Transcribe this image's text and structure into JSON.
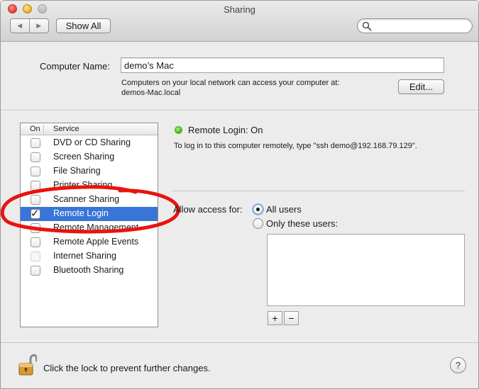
{
  "window": {
    "title": "Sharing"
  },
  "toolbar": {
    "back_label": "◀",
    "forward_label": "▶",
    "show_all_label": "Show All",
    "search": {
      "value": "",
      "placeholder": ""
    }
  },
  "computer_name": {
    "label": "Computer Name:",
    "value": "demo’s Mac",
    "info_line1": "Computers on your local network can access your computer at:",
    "info_line2": "demos-Mac.local",
    "edit_label": "Edit..."
  },
  "services": {
    "header_on": "On",
    "header_service": "Service",
    "items": [
      {
        "label": "DVD or CD Sharing",
        "checked": false,
        "enabled": true,
        "selected": false
      },
      {
        "label": "Screen Sharing",
        "checked": false,
        "enabled": true,
        "selected": false
      },
      {
        "label": "File Sharing",
        "checked": false,
        "enabled": true,
        "selected": false
      },
      {
        "label": "Printer Sharing",
        "checked": false,
        "enabled": true,
        "selected": false
      },
      {
        "label": "Scanner Sharing",
        "checked": false,
        "enabled": true,
        "selected": false
      },
      {
        "label": "Remote Login",
        "checked": true,
        "enabled": true,
        "selected": true
      },
      {
        "label": "Remote Management",
        "checked": false,
        "enabled": true,
        "selected": false
      },
      {
        "label": "Remote Apple Events",
        "checked": false,
        "enabled": true,
        "selected": false
      },
      {
        "label": "Internet Sharing",
        "checked": false,
        "enabled": false,
        "selected": false
      },
      {
        "label": "Bluetooth Sharing",
        "checked": false,
        "enabled": true,
        "selected": false
      }
    ]
  },
  "detail": {
    "status": "Remote Login: On",
    "status_color": "#4fb522",
    "instructions": "To log in to this computer remotely, type \"ssh demo@192.168.79.129\".",
    "allow_label": "Allow access for:",
    "option_all": "All users",
    "option_only": "Only these users:",
    "selected_option": "All users",
    "add_label": "+",
    "remove_label": "−"
  },
  "footer": {
    "lock_text": "Click the lock to prevent further changes.",
    "help_label": "?"
  },
  "annotation": {
    "color": "#e8140f",
    "shape": "hand-drawn-ellipse"
  }
}
